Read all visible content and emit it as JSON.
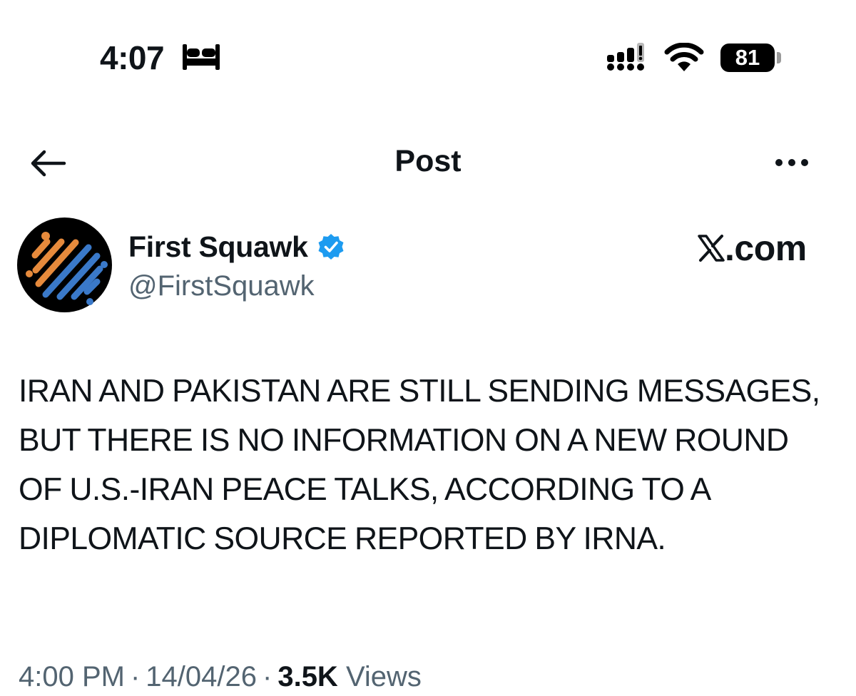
{
  "status_bar": {
    "time": "4:07",
    "sleep_icon": "bed-icon",
    "signal_icon": "cellular-signal-icon",
    "wifi_icon": "wifi-icon",
    "battery_level": "81"
  },
  "nav": {
    "back_icon": "arrow-left-icon",
    "title": "Post",
    "more_icon": "more-horizontal-icon"
  },
  "author": {
    "name": "First Squawk",
    "handle": "@FirstSquawk",
    "verified_icon": "verified-badge-icon",
    "verified_color": "#1d9bf0",
    "avatar_colors": {
      "background": "#000000",
      "orange": "#e68a3c",
      "blue": "#3a79c9"
    }
  },
  "watermark": {
    "logo_icon": "x-logo-icon",
    "domain": ".com"
  },
  "post": {
    "text": "IRAN AND PAKISTAN ARE STILL SENDING MESSAGES, BUT THERE IS NO INFORMATION ON A NEW ROUND OF U.S.-IRAN PEACE TALKS, ACCORDING TO A DIPLOMATIC SOURCE REPORTED BY IRNA."
  },
  "meta": {
    "time": "4:00 PM",
    "separator": "·",
    "date": "14/04/26",
    "views_count": "3.5K",
    "views_label": "Views"
  },
  "colors": {
    "text_primary": "#0f1419",
    "text_secondary": "#536471",
    "background": "#ffffff"
  }
}
